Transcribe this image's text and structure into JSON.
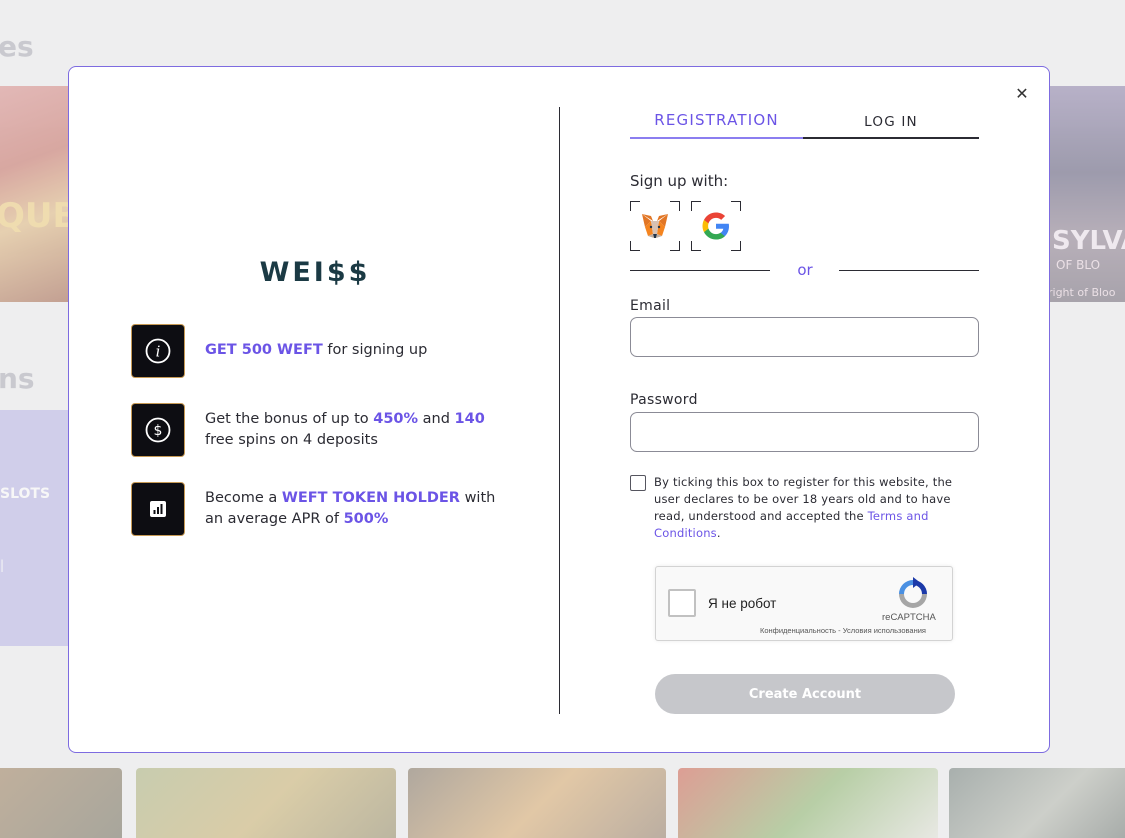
{
  "background": {
    "heading_top": "es",
    "heading_middle": "ns",
    "card_left_text": "QUB",
    "card_right_text": "SYLVA",
    "card_right_sub": "OF BLO",
    "card_right_sub2": "right of Bloo",
    "panel_text": "SLOTS",
    "panel_text2": "| "
  },
  "modal": {
    "close_symbol": "✕",
    "left": {
      "logo": "WEI$$",
      "benefits": [
        {
          "icon": "info-icon",
          "parts": [
            "",
            "GET 500 WEFT",
            " for signing up",
            "",
            ""
          ]
        },
        {
          "icon": "dollar-icon",
          "parts": [
            "Get the bonus of up to ",
            "450%",
            " and ",
            "140",
            " free spins on 4 deposits"
          ]
        },
        {
          "icon": "chart-icon",
          "parts": [
            "Become a ",
            "WEFT TOKEN HOLDER",
            " with an average APR of ",
            "500%",
            ""
          ]
        }
      ]
    },
    "tabs": {
      "registration": "REGISTRATION",
      "login": "LOG IN"
    },
    "signup_with": "Sign up with:",
    "social": [
      {
        "name": "metamask",
        "icon": "metamask-fox-icon"
      },
      {
        "name": "google",
        "icon": "google-g-icon"
      }
    ],
    "or": "or",
    "email_label": "Email",
    "email_value": "",
    "password_label": "Password",
    "password_value": "",
    "terms": {
      "checked": false,
      "text": "By ticking this box to register for this website, the user declares to be over 18 years old and to have read, understood and accepted the ",
      "link": "Terms and Conditions",
      "end": "."
    },
    "recaptcha": {
      "label": "Я не робот",
      "brand": "reCAPTCHA",
      "privacy": "Конфиденциальность",
      "separator": " - ",
      "terms": "Условия использования"
    },
    "create_button": "Create Account",
    "colors": {
      "accent": "#6b54e6",
      "modal_border": "#7d6be0",
      "button_disabled": "#c6c7cb",
      "logo": "#1b3a44"
    }
  }
}
